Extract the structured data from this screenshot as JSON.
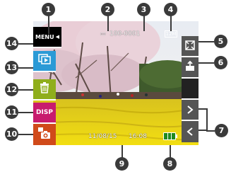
{
  "display": {
    "file_number": "100-0001",
    "image_size": "12M",
    "date": "11/08/15",
    "time": "16:08"
  },
  "left_panel": {
    "menu_label": "MENU",
    "disp_label": "DISP"
  },
  "callouts": [
    "1",
    "2",
    "3",
    "4",
    "5",
    "6",
    "7",
    "8",
    "9",
    "10",
    "11",
    "12",
    "13",
    "14"
  ],
  "colors": {
    "menu": "#000000",
    "slideshow": "#2b9ad6",
    "delete": "#8fae1b",
    "disp": "#c81b6e",
    "print": "#d04a1a",
    "right_panel": "#555555",
    "callout": "#3a3a3a"
  },
  "icons": [
    "slideshow-icon",
    "trash-icon",
    "print-camera-icon",
    "zoom-icon",
    "rotate-icon",
    "chevron-right-icon",
    "chevron-left-icon",
    "battery-icon",
    "memory-icon"
  ]
}
